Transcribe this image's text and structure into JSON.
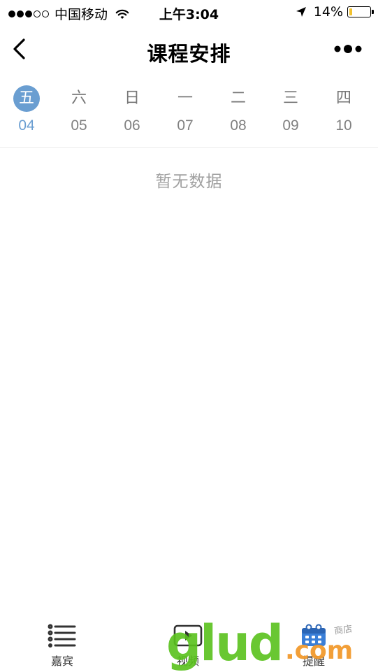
{
  "status_bar": {
    "carrier": "中国移动",
    "time": "上午3:04",
    "battery_percent": "14%",
    "battery_level": 0.14,
    "signal_strength": 3,
    "signal_max": 5,
    "icons": [
      "wifi-icon",
      "location-arrow-icon",
      "battery-icon"
    ]
  },
  "nav": {
    "title": "课程安排",
    "back_icon": "chevron-left-icon",
    "more_icon": "more-dots-icon"
  },
  "days": [
    {
      "weekday": "五",
      "date": "04",
      "active": true
    },
    {
      "weekday": "六",
      "date": "05",
      "active": false
    },
    {
      "weekday": "日",
      "date": "06",
      "active": false
    },
    {
      "weekday": "一",
      "date": "07",
      "active": false
    },
    {
      "weekday": "二",
      "date": "08",
      "active": false
    },
    {
      "weekday": "三",
      "date": "09",
      "active": false
    },
    {
      "weekday": "四",
      "date": "10",
      "active": false
    }
  ],
  "empty_state": {
    "text": "暂无数据"
  },
  "tabs": [
    {
      "label": "嘉宾",
      "icon": "list-icon"
    },
    {
      "label": "视频",
      "icon": "video-icon"
    },
    {
      "label": "提醒",
      "icon": "calendar-icon"
    }
  ],
  "watermark": {
    "logo": "glud",
    "domain": ".com",
    "tagline": "商店"
  },
  "colors": {
    "accent": "#6a9ed1",
    "muted_text": "#808080",
    "empty_text": "#a0a0a0",
    "battery_fill": "#f2c230",
    "calendar_blue": "#3a7fd8"
  }
}
